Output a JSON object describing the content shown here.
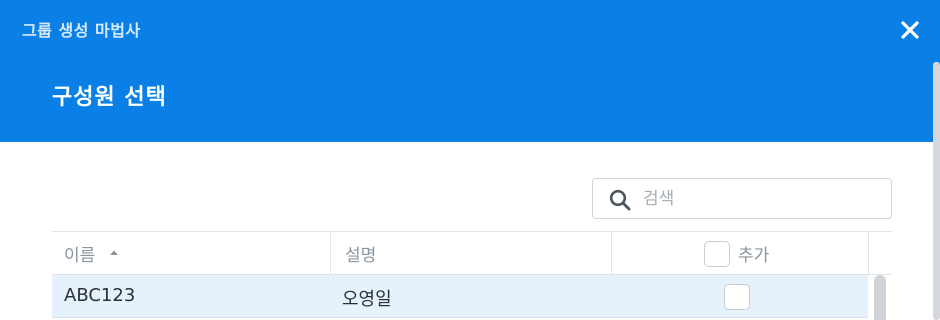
{
  "dialog": {
    "wizard_title": "그룹 생성 마법사",
    "step_title": "구성원 선택",
    "close_icon": "close-icon"
  },
  "search": {
    "placeholder": "검색",
    "value": "",
    "icon": "search-icon"
  },
  "grid": {
    "columns": [
      {
        "label": "이름",
        "sort": "ascending"
      },
      {
        "label": "설명"
      },
      {
        "label": "추가"
      }
    ],
    "header_checkbox_checked": false,
    "rows": [
      {
        "name": "ABC123",
        "description": "오영일",
        "added": false,
        "selected": true
      }
    ]
  },
  "colors": {
    "header_bg": "#0a80e6",
    "selected_row_bg": "#e5f1fc"
  }
}
